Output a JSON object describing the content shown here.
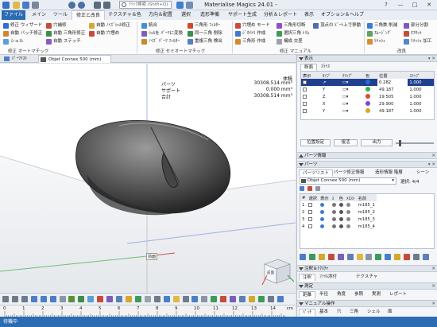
{
  "app": {
    "title": "Materialise Magics 24.01 -",
    "search_placeholder": "ｸｲｯｸ検索 (Shift+Q)",
    "window_controls": [
      "?",
      "—",
      "□",
      "✕"
    ]
  },
  "tabs": [
    {
      "label": "ファイル",
      "active": false
    },
    {
      "label": "メイン",
      "active": false
    },
    {
      "label": "ツール",
      "active": false
    },
    {
      "label": "修正と改良",
      "active": true
    },
    {
      "label": "テクスチャ＆色",
      "active": false
    },
    {
      "label": "方向＆配置",
      "active": false
    },
    {
      "label": "選択",
      "active": false
    },
    {
      "label": "造形準備",
      "active": false
    },
    {
      "label": "サポート生成",
      "active": false
    },
    {
      "label": "分析＆レポート",
      "active": false
    },
    {
      "label": "表示",
      "active": false
    },
    {
      "label": "オプション＆ヘルプ",
      "active": false
    }
  ],
  "ribbon": {
    "auto_fix": {
      "label": "修正 オートマチック",
      "buttons": [
        "修正 ウィザード",
        "自動 バッチ修正",
        "シェル",
        "穴補修",
        "自動 三角形修正",
        "自動 ステッチ",
        "自動 ﾉｲｽﾞｼｪﾙ修正",
        "自動 穴埋め"
      ]
    },
    "semi_auto_fix": {
      "label": "修正 セミオートマチック",
      "buttons": [
        "統合",
        "ｼｪﾙを ﾊﾟｰﾂに変換",
        "ﾉｲｽﾞ ﾊﾟｰﾂ ﾌｨﾙﾀｰ",
        "三角形 ﾌｨﾙﾀｰ",
        "同一三角 削除",
        "重複三角 検出"
      ]
    },
    "manual_fix": {
      "label": "修正 マニュアル",
      "buttons": [
        "穴埋め モード",
        "ｼﾞｵﾒﾄﾘ 作成",
        "三角形 作成",
        "三角形切断",
        "選択三角 ﾄﾘﾑ",
        "構成 交差",
        "頂点の ﾋﾞｰﾄ上で移動"
      ]
    },
    "improve": {
      "label": "改良",
      "buttons": [
        "三角数 削減",
        "ｽﾑｰｼﾞﾝｸﾞ",
        "ﾘﾒｯｼｭ",
        "部分分割",
        "ｵﾌｾｯﾄ",
        "ﾘﾒｯｼｭ 加工"
      ]
    }
  },
  "doc_tabs": [
    "ﾊﾟｰﾂﾘｽﾄ",
    "Objet Connex 500 (mm)"
  ],
  "viewport": {
    "info_labels": [
      "パーツ",
      "サポート",
      "合計"
    ],
    "info_header": "体積",
    "info_values": [
      "30308.514 mm³",
      "0.000 mm³",
      "30308.514 mm³"
    ],
    "front_label": "前面",
    "cube_label": "前面"
  },
  "ruler": {
    "ticks": [
      "0",
      "1",
      "2",
      "3",
      "4",
      "5",
      "6",
      "7",
      "8",
      "9",
      "10",
      "11",
      "12",
      "13",
      "14"
    ],
    "unit": "cm"
  },
  "status_text": "待機中",
  "panel": {
    "display": {
      "title": "表示",
      "subtabs": [
        "断面",
        "ｽﾗｲｽ"
      ],
      "columns": [
        "表示",
        "ﾀｲﾌﾟ",
        "ｸﾘｯﾌﾟ",
        "色",
        "位置",
        "ｽﾃｯﾌﾟ"
      ],
      "rows": [
        {
          "type": "↗",
          "color": "#2a6ad8",
          "position": "0.282",
          "step": "1.000",
          "selected": true
        },
        {
          "type": "Y",
          "color": "#2fb34a",
          "position": "49.187",
          "step": "1.000",
          "selected": false
        },
        {
          "type": "Z",
          "color": "#e04a2a",
          "position": "19.505",
          "step": "1.000",
          "selected": false
        },
        {
          "type": "X",
          "color": "#8a3fd0",
          "position": "29.900",
          "step": "1.000",
          "selected": false
        },
        {
          "type": "Y",
          "color": "#e0a420",
          "position": "49.187",
          "step": "1.000",
          "selected": false
        }
      ],
      "buttons": [
        "位置設定",
        "復活",
        "出力"
      ]
    },
    "part_info": {
      "title": "パーツ情報"
    },
    "parts": {
      "title": "パーツ",
      "subtabs": [
        "パーツリスト",
        "パーツ修正情報",
        "造形情報 階層",
        "シーン"
      ],
      "machine": "Objet Connex 500 (mm)",
      "count": "選択: 4/4",
      "columns": [
        "#",
        "選択",
        "表示",
        "ｽ",
        "色",
        "ﾒﾛｽﾄ",
        "名前"
      ],
      "rows": [
        {
          "num": "1",
          "name": "m185_1"
        },
        {
          "num": "2",
          "name": "m185_2"
        },
        {
          "num": "3",
          "name": "m185_3"
        },
        {
          "num": "4",
          "name": "m185_4"
        }
      ]
    },
    "annotations": {
      "title": "注釈＆ﾃｸｽﾁｬ",
      "subtabs": [
        "注釈",
        "ﾌｧｲﾙ添付",
        "テクスチャ"
      ]
    },
    "measure": {
      "title": "測定",
      "subtabs": [
        "距離",
        "半径",
        "角度",
        "参照",
        "実測",
        "レポート"
      ]
    },
    "manual_ops": {
      "title": "マニュアル操作",
      "subtabs": [
        "ﾊﾟｯﾁ",
        "基本",
        "穴",
        "三角",
        "シェル",
        "面"
      ]
    }
  }
}
